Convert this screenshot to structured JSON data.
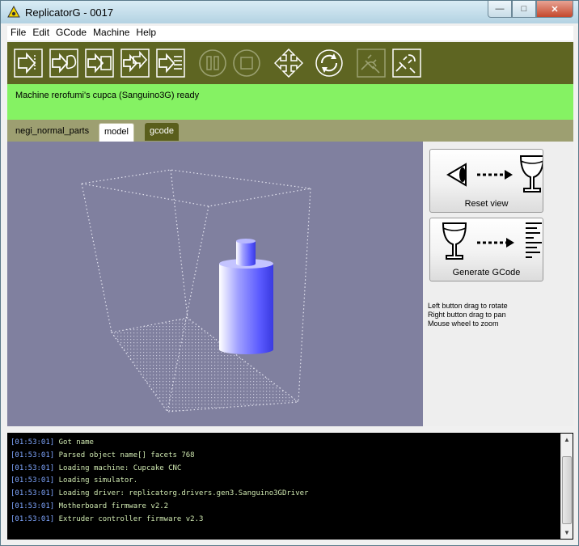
{
  "window": {
    "title": "ReplicatorG - 0017",
    "controls": [
      "minimize",
      "maximize",
      "close"
    ]
  },
  "menu": [
    "File",
    "Edit",
    "GCode",
    "Machine",
    "Help"
  ],
  "toolbar": {
    "buttons": [
      {
        "name": "build-button",
        "icon": "build-icon",
        "enabled": true
      },
      {
        "name": "upload-button",
        "icon": "upload-icon",
        "enabled": true
      },
      {
        "name": "build-to-file-button",
        "icon": "build-to-file-icon",
        "enabled": true
      },
      {
        "name": "build-remote-button",
        "icon": "build-remote-icon",
        "enabled": true
      },
      {
        "name": "simulate-button",
        "icon": "simulate-icon",
        "enabled": true
      },
      {
        "name": "pause-button",
        "icon": "pause-icon",
        "enabled": false
      },
      {
        "name": "stop-button",
        "icon": "stop-icon",
        "enabled": false
      },
      {
        "name": "control-panel-button",
        "icon": "move-arrows-icon",
        "enabled": true
      },
      {
        "name": "reset-button",
        "icon": "refresh-icon",
        "enabled": true
      },
      {
        "name": "connect-button",
        "icon": "plug-connect-icon",
        "enabled": false
      },
      {
        "name": "disconnect-button",
        "icon": "plug-disconnect-icon",
        "enabled": true
      }
    ]
  },
  "status": {
    "text": "Machine rerofumi's cupca (Sanguino3G) ready"
  },
  "tabs": [
    {
      "label": "negi_normal_parts",
      "state": "plain"
    },
    {
      "label": "model",
      "state": "active"
    },
    {
      "label": "gcode",
      "state": "inactive"
    }
  ],
  "side": {
    "reset_label": "Reset view",
    "generate_label": "Generate GCode",
    "help": [
      "Left button drag to rotate",
      "Right button drag to pan",
      "Mouse wheel to zoom"
    ]
  },
  "console": {
    "lines": [
      {
        "time": "[01:53:01]",
        "msg": "Got name"
      },
      {
        "time": "[01:53:01]",
        "msg": "Parsed object name[] facets 768"
      },
      {
        "time": "[01:53:01]",
        "msg": "Loading machine: Cupcake CNC"
      },
      {
        "time": "[01:53:01]",
        "msg": "Loading simulator."
      },
      {
        "time": "[01:53:01]",
        "msg": "Loading driver: replicatorg.drivers.gen3.Sanguino3GDriver"
      },
      {
        "time": "[01:53:01]",
        "msg": "Motherboard firmware v2.2"
      },
      {
        "time": "[01:53:01]",
        "msg": "Extruder controller firmware v2.3"
      }
    ]
  },
  "colors": {
    "toolbar": "#5e6522",
    "status": "#85f263",
    "tabbar": "#9d9f71",
    "viewport": "#80809f",
    "model": "#5a5aff"
  }
}
